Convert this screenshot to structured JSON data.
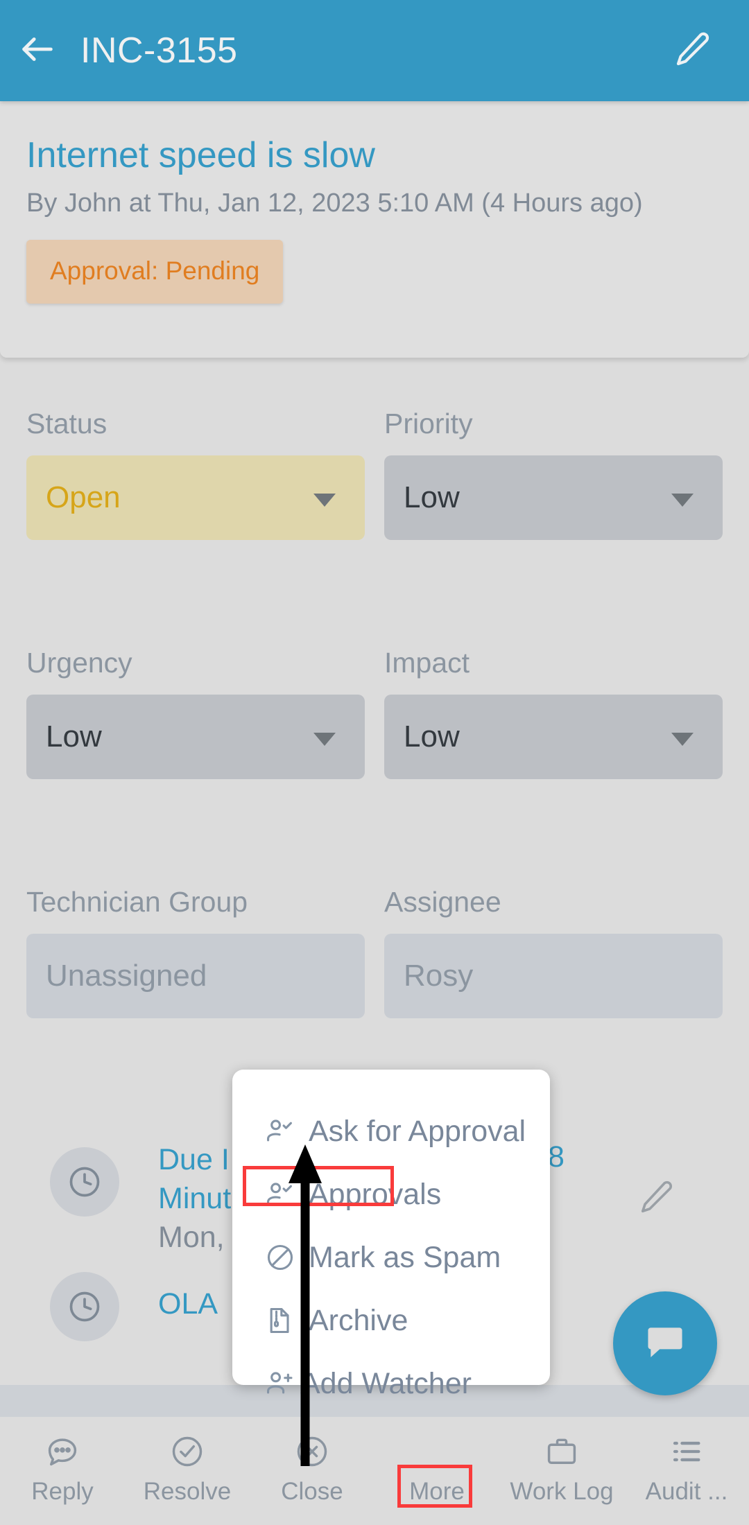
{
  "appbar": {
    "back_icon": "arrow-left-icon",
    "title": "INC-3155",
    "edit_icon": "pencil-icon"
  },
  "summary": {
    "title": "Internet speed is slow",
    "meta": "By John at Thu, Jan 12, 2023 5:10 AM (4 Hours ago)",
    "badge": "Approval: Pending",
    "badge_bg": "#e4c9ae",
    "badge_color": "#e07d20"
  },
  "fields": [
    {
      "label": "Status",
      "value": "Open",
      "variant": "status-open",
      "caret": true
    },
    {
      "label": "Priority",
      "value": "Low",
      "variant": "",
      "caret": true
    },
    {
      "label": "Urgency",
      "value": "Low",
      "variant": "",
      "caret": true
    },
    {
      "label": "Impact",
      "value": "Low",
      "variant": "",
      "caret": true
    },
    {
      "label": "Technician Group",
      "value": "Unassigned",
      "variant": "plain",
      "caret": false
    },
    {
      "label": "Assignee",
      "value": "Rosy",
      "variant": "plain",
      "caret": false
    }
  ],
  "sla": [
    {
      "icon": "clock-icon",
      "line1_link": "Due I",
      "line1_tail": "8",
      "line2_link": "Minut",
      "line3_dim": "Mon,",
      "edit_icon": "pencil-icon"
    },
    {
      "icon": "clock-icon",
      "line1_link": "OLA "
    }
  ],
  "popup": {
    "items": [
      {
        "label": "Ask for Approval",
        "icon": "user-check-icon"
      },
      {
        "label": "Approvals",
        "icon": "user-check-icon",
        "highlighted": true
      },
      {
        "label": "Mark as Spam",
        "icon": "block-icon"
      },
      {
        "label": "Archive",
        "icon": "archive-file-icon"
      },
      {
        "label": "Add Watcher",
        "icon": "user-plus-icon"
      }
    ]
  },
  "bottomnav": {
    "items": [
      {
        "label": "Reply",
        "icon": "comment-dots-icon"
      },
      {
        "label": "Resolve",
        "icon": "check-circle-icon"
      },
      {
        "label": "Close",
        "icon": "close-circle-icon"
      },
      {
        "label": "More",
        "icon": "more-icon",
        "highlighted": true
      },
      {
        "label": "Work Log",
        "icon": "briefcase-icon"
      },
      {
        "label": "Audit ...",
        "icon": "list-icon"
      }
    ]
  },
  "fab": {
    "icon": "chat-icon",
    "color": "#3498c2"
  },
  "annotations": {
    "highlight_color": "#f93b3b",
    "arrow_color": "#000000",
    "arrow_points_to": "Approvals"
  },
  "theme": {
    "accent": "#3498c2",
    "page_bg": "#dcdcdc",
    "label_color": "#8b95a0"
  }
}
